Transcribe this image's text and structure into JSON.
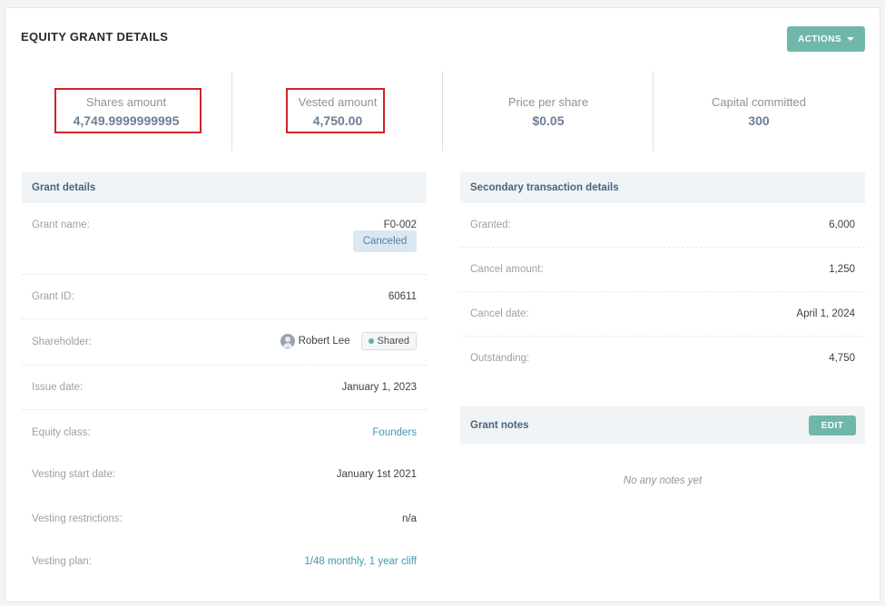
{
  "title": "EQUITY GRANT DETAILS",
  "actions_label": "ACTIONS",
  "stats": [
    {
      "label": "Shares amount",
      "value": "4,749.9999999995"
    },
    {
      "label": "Vested amount",
      "value": "4,750.00"
    },
    {
      "label": "Price per share",
      "value": "$0.05"
    },
    {
      "label": "Capital committed",
      "value": "300"
    }
  ],
  "grant_details": {
    "heading": "Grant details",
    "grant_name_label": "Grant name:",
    "grant_name": "F0-002",
    "status_badge": "Canceled",
    "grant_id_label": "Grant ID:",
    "grant_id": "60611",
    "shareholder_label": "Shareholder:",
    "shareholder": "Robert Lee",
    "shared_badge": "Shared",
    "issue_date_label": "Issue date:",
    "issue_date": "January 1, 2023",
    "equity_class_label": "Equity class:",
    "equity_class": "Founders",
    "vesting_start_label": "Vesting start date:",
    "vesting_start": "January 1st 2021",
    "vesting_restrictions_label": "Vesting restrictions:",
    "vesting_restrictions": "n/a",
    "vesting_plan_label": "Vesting plan:",
    "vesting_plan": "1/48 monthly, 1 year cliff"
  },
  "secondary": {
    "heading": "Secondary transaction details",
    "granted_label": "Granted:",
    "granted": "6,000",
    "cancel_amount_label": "Cancel amount:",
    "cancel_amount": "1,250",
    "cancel_date_label": "Cancel date:",
    "cancel_date": "April 1, 2024",
    "outstanding_label": "Outstanding:",
    "outstanding": "4,750"
  },
  "notes": {
    "heading": "Grant notes",
    "edit_label": "EDIT",
    "empty_text": "No any notes yet"
  },
  "colors": {
    "accent": "#6fb7a9",
    "link": "#3f97b3",
    "highlight": "#d0242b"
  }
}
